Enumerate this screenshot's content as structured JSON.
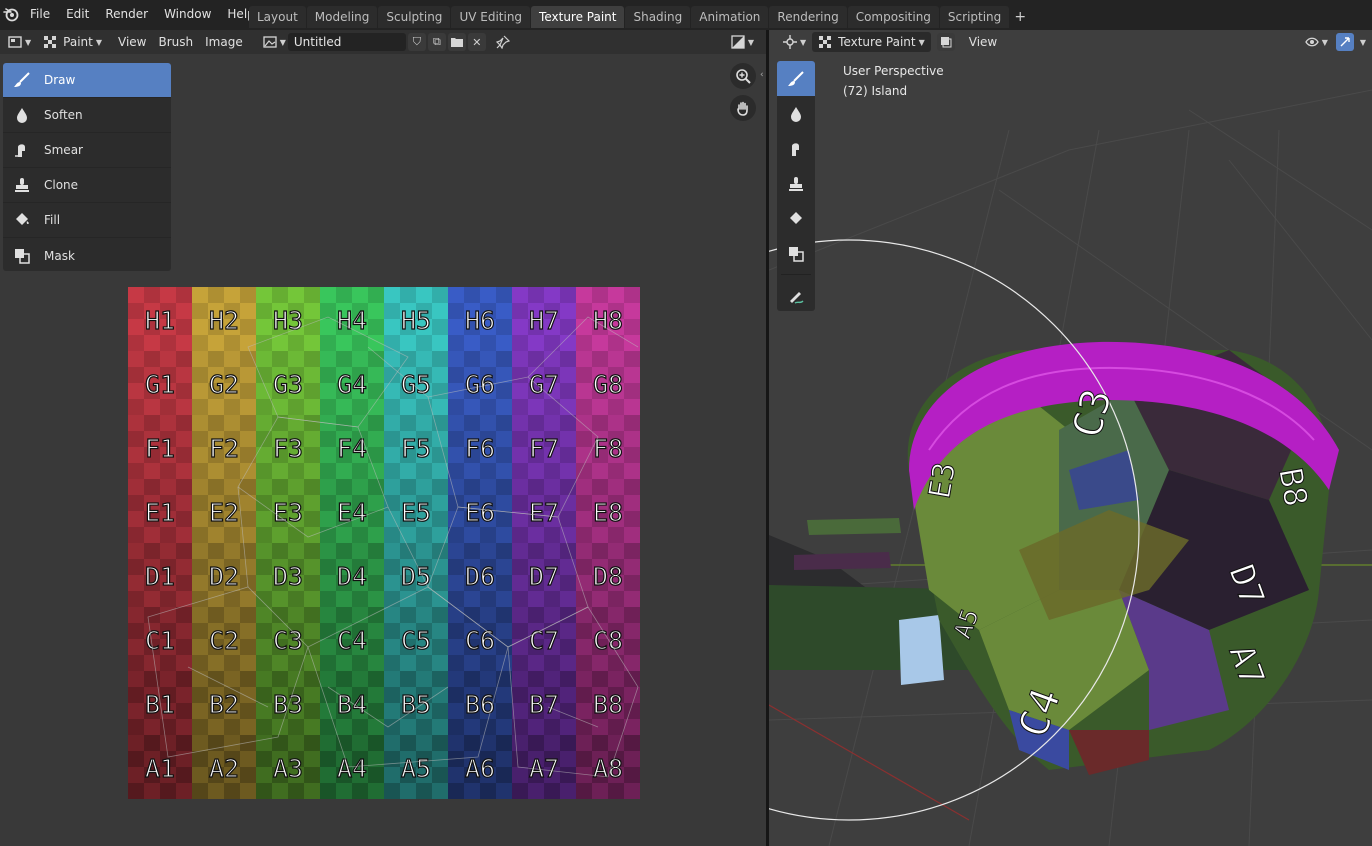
{
  "menu": [
    "File",
    "Edit",
    "Render",
    "Window",
    "Help"
  ],
  "workspaces": [
    "Layout",
    "Modeling",
    "Sculpting",
    "UV Editing",
    "Texture Paint",
    "Shading",
    "Animation",
    "Rendering",
    "Compositing",
    "Scripting"
  ],
  "active_workspace": "Texture Paint",
  "add_workspace": "+",
  "image_editor": {
    "mode": "Paint",
    "menus": [
      "View",
      "Brush",
      "Image"
    ],
    "image_name": "Untitled",
    "tools": [
      "Draw",
      "Soften",
      "Smear",
      "Clone",
      "Fill",
      "Mask"
    ],
    "active_tool": "Draw",
    "grid_rows": [
      "H",
      "G",
      "F",
      "E",
      "D",
      "C",
      "B",
      "A"
    ],
    "grid_cols": [
      "1",
      "2",
      "3",
      "4",
      "5",
      "6",
      "7",
      "8"
    ]
  },
  "viewport": {
    "mode": "Texture Paint",
    "menu_view": "View",
    "perspective": "User Perspective",
    "object": "(72) Island",
    "mesh_labels": [
      "E3",
      "C3",
      "B8",
      "D7",
      "A7",
      "A5",
      "C4"
    ]
  },
  "colors": {
    "accent": "#5680c2",
    "magenta_cap": "#b51fc4"
  }
}
